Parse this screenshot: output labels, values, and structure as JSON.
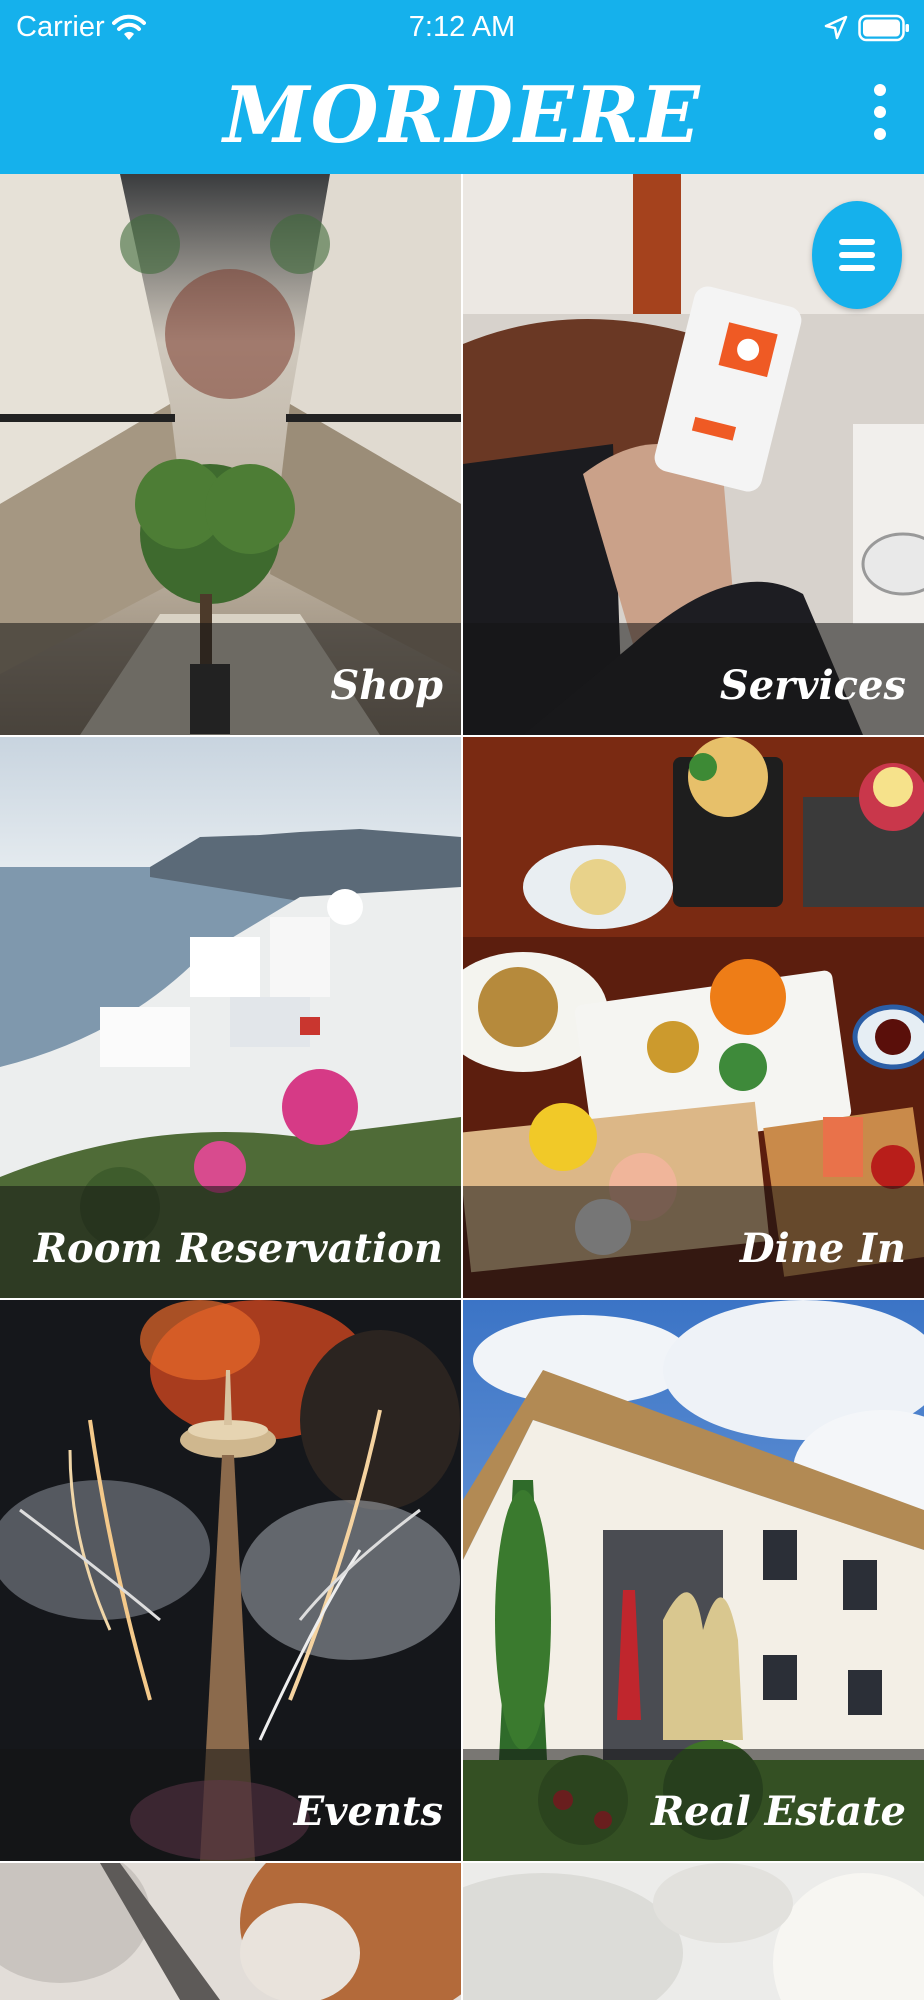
{
  "status_bar": {
    "carrier": "Carrier",
    "time": "7:12 AM",
    "icons": [
      "wifi-icon",
      "location-icon",
      "battery-icon"
    ]
  },
  "header": {
    "title": "MORDERE",
    "menu_icon": "more-vertical-icon",
    "background_color": "#15b1ec"
  },
  "tiles": [
    {
      "label": "Shop",
      "image": "shopping-mall-interior"
    },
    {
      "label": "Services",
      "image": "hand-holding-phone"
    },
    {
      "label": "Room Reservation",
      "image": "santorini-coastline"
    },
    {
      "label": "Dine In",
      "image": "japanese-food-platter"
    },
    {
      "label": "Events",
      "image": "space-needle-fireworks"
    },
    {
      "label": "Real Estate",
      "image": "modern-house"
    },
    {
      "label": "",
      "image": "partial-tile-left"
    },
    {
      "label": "",
      "image": "partial-tile-right"
    }
  ],
  "fab": {
    "icon": "hamburger-menu-icon"
  }
}
